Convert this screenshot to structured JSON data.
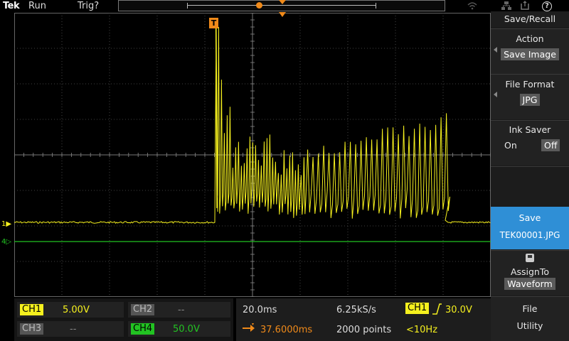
{
  "topbar": {
    "brand": "Tek",
    "run_status": "Run",
    "trigger_status": "Trig?"
  },
  "colors": {
    "ch1": "#f5f01e",
    "ch4": "#22c322",
    "trigger": "#f08a1a",
    "menu_highlight": "#2f8fd6"
  },
  "display": {
    "trigger_marker_label": "T",
    "ch1_marker": "1",
    "ch4_marker": "4"
  },
  "side_menu": {
    "title": "Save/Recall",
    "action_label": "Action",
    "action_value": "Save Image",
    "format_label": "File Format",
    "format_value": "JPG",
    "ink_saver_label": "Ink Saver",
    "ink_on": "On",
    "ink_off": "Off",
    "save_label": "Save",
    "save_filename": "TEK00001.JPG",
    "assign_label": "AssignTo",
    "assign_value": "Waveform",
    "file_utility_1": "File",
    "file_utility_2": "Utility"
  },
  "channels": {
    "ch1": {
      "label": "CH1",
      "scale": "5.00V"
    },
    "ch2": {
      "label": "CH2",
      "scale": "--"
    },
    "ch3": {
      "label": "CH3",
      "scale": "--"
    },
    "ch4": {
      "label": "CH4",
      "scale": "50.0V"
    }
  },
  "horizontal": {
    "timebase": "20.0ms",
    "sample_rate": "6.25kS/s",
    "position": "37.6000ms",
    "record_length": "2000 points"
  },
  "trigger": {
    "source": "CH1",
    "level": "30.0V",
    "frequency": "<10Hz"
  },
  "icons": [
    "wifi-icon",
    "network-icon",
    "usb-icon",
    "help-icon",
    "save-icon",
    "trigger-slope-icon"
  ]
}
